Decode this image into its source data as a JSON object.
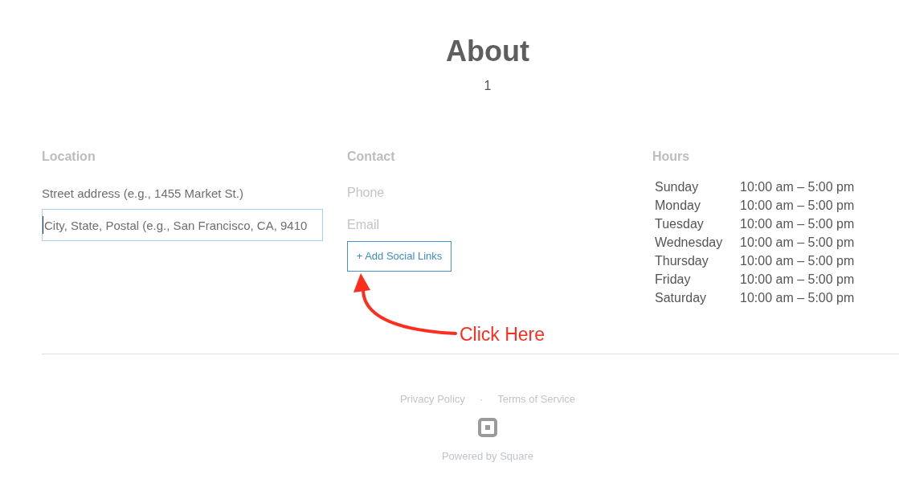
{
  "page": {
    "title": "About",
    "subtitle": "1"
  },
  "location": {
    "heading": "Location",
    "fields": [
      {
        "placeholder": "Street address (e.g., 1455 Market St.)",
        "focused": false
      },
      {
        "placeholder": "City, State, Postal (e.g., San Francisco, CA, 9410",
        "focused": true
      }
    ]
  },
  "contact": {
    "heading": "Contact",
    "fields": [
      {
        "placeholder": "Phone"
      },
      {
        "placeholder": "Email"
      }
    ],
    "social_button": "+ Add Social Links"
  },
  "hours": {
    "heading": "Hours",
    "rows": [
      {
        "day": "Sunday",
        "time": "10:00 am – 5:00 pm"
      },
      {
        "day": "Monday",
        "time": "10:00 am – 5:00 pm"
      },
      {
        "day": "Tuesday",
        "time": "10:00 am – 5:00 pm"
      },
      {
        "day": "Wednesday",
        "time": "10:00 am – 5:00 pm"
      },
      {
        "day": "Thursday",
        "time": "10:00 am – 5:00 pm"
      },
      {
        "day": "Friday",
        "time": "10:00 am – 5:00 pm"
      },
      {
        "day": "Saturday",
        "time": "10:00 am – 5:00 pm"
      }
    ]
  },
  "annotation": {
    "label": "Click Here"
  },
  "footer": {
    "links": [
      "Privacy Policy",
      "Terms of Service"
    ],
    "separator": "·",
    "powered_by": "Powered by Square"
  }
}
